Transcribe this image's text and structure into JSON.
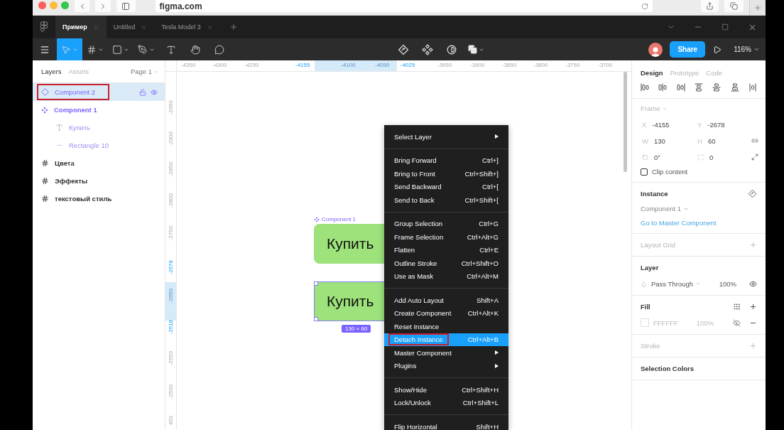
{
  "browser": {
    "url": "figma.com"
  },
  "file_tabs": [
    {
      "label": "Пример",
      "selected": true
    },
    {
      "label": "Untitled",
      "selected": false
    },
    {
      "label": "Tesla Model 3",
      "selected": false
    }
  ],
  "toolbar": {
    "tools": [
      {
        "kind": "move",
        "selected": true
      },
      {
        "kind": "frame",
        "selected": false
      },
      {
        "kind": "shape",
        "selected": false
      },
      {
        "kind": "pen",
        "selected": false
      },
      {
        "kind": "text",
        "selected": false
      },
      {
        "kind": "hand",
        "selected": false
      },
      {
        "kind": "comment",
        "selected": false
      }
    ],
    "share": "Share",
    "zoom": "116%"
  },
  "left_panel": {
    "tabs": [
      {
        "label": "Layers",
        "selected": true
      },
      {
        "label": "Assets",
        "selected": false
      }
    ],
    "page": "Page 1",
    "layers": [
      {
        "kind": "instance",
        "name": "Component 2",
        "selected": true,
        "annotated": true
      },
      {
        "kind": "component",
        "name": "Component 1",
        "selected": false,
        "annotated": false,
        "children": [
          {
            "kind": "text",
            "name": "Купить",
            "selected": false,
            "annotated": false
          },
          {
            "kind": "rectangle",
            "name": "Rectangle 10",
            "selected": false,
            "annotated": false
          }
        ]
      },
      {
        "kind": "frame",
        "name": "Цвета",
        "selected": false,
        "annotated": false
      },
      {
        "kind": "frame",
        "name": "Эффекты",
        "selected": false,
        "annotated": false
      },
      {
        "kind": "frame",
        "name": "текстовый стиль",
        "selected": false,
        "annotated": false
      }
    ]
  },
  "rulers": {
    "top": [
      {
        "label": "-4350",
        "kind": "plain"
      },
      {
        "label": "-4300",
        "kind": "plain"
      },
      {
        "label": "-4250",
        "kind": "plain"
      },
      {
        "label": "-4155",
        "kind": "edge"
      },
      {
        "label": "-4100",
        "kind": "inner"
      },
      {
        "label": "-4050",
        "kind": "inner"
      },
      {
        "label": "-4025",
        "kind": "edge"
      },
      {
        "label": "-3950",
        "kind": "plain"
      },
      {
        "label": "-3900",
        "kind": "plain"
      },
      {
        "label": "-3850",
        "kind": "plain"
      },
      {
        "label": "-3800",
        "kind": "plain"
      },
      {
        "label": "-3750",
        "kind": "plain"
      },
      {
        "label": "-3700",
        "kind": "plain"
      }
    ],
    "left": [
      {
        "label": "-2950",
        "kind": "plain"
      },
      {
        "label": "-2900",
        "kind": "plain"
      },
      {
        "label": "-2850",
        "kind": "plain"
      },
      {
        "label": "-2800",
        "kind": "plain"
      },
      {
        "label": "-2750",
        "kind": "plain"
      },
      {
        "label": "-2678",
        "kind": "edge"
      },
      {
        "label": "-2650",
        "kind": "inner"
      },
      {
        "label": "-2618",
        "kind": "edge"
      },
      {
        "label": "-2550",
        "kind": "plain"
      },
      {
        "label": "-2500",
        "kind": "plain"
      },
      {
        "label": "450",
        "kind": "plain"
      }
    ]
  },
  "canvas": {
    "component_label": "Component 1",
    "buttons": [
      {
        "label": "Купить",
        "selected": false
      },
      {
        "label": "Купить",
        "selected": true
      }
    ],
    "size_badge": "130 × 60"
  },
  "context_menu": {
    "sections": [
      [
        {
          "label": "Select Layer",
          "submenu": true,
          "selected": false,
          "annotated": false
        }
      ],
      [
        {
          "label": "Bring Forward",
          "shortcut": "Ctrl+]",
          "submenu": false,
          "selected": false,
          "annotated": false
        },
        {
          "label": "Bring to Front",
          "shortcut": "Ctrl+Shift+]",
          "submenu": false,
          "selected": false,
          "annotated": false
        },
        {
          "label": "Send Backward",
          "shortcut": "Ctrl+[",
          "submenu": false,
          "selected": false,
          "annotated": false
        },
        {
          "label": "Send to Back",
          "shortcut": "Ctrl+Shift+[",
          "submenu": false,
          "selected": false,
          "annotated": false
        }
      ],
      [
        {
          "label": "Group Selection",
          "shortcut": "Ctrl+G",
          "submenu": false,
          "selected": false,
          "annotated": false
        },
        {
          "label": "Frame Selection",
          "shortcut": "Ctrl+Alt+G",
          "submenu": false,
          "selected": false,
          "annotated": false
        },
        {
          "label": "Flatten",
          "shortcut": "Ctrl+E",
          "submenu": false,
          "selected": false,
          "annotated": false
        },
        {
          "label": "Outline Stroke",
          "shortcut": "Ctrl+Shift+O",
          "submenu": false,
          "selected": false,
          "annotated": false
        },
        {
          "label": "Use as Mask",
          "shortcut": "Ctrl+Alt+M",
          "submenu": false,
          "selected": false,
          "annotated": false
        }
      ],
      [
        {
          "label": "Add Auto Layout",
          "shortcut": "Shift+A",
          "submenu": false,
          "selected": false,
          "annotated": false
        },
        {
          "label": "Create Component",
          "shortcut": "Ctrl+Alt+K",
          "submenu": false,
          "selected": false,
          "annotated": false
        },
        {
          "label": "Reset Instance",
          "submenu": false,
          "selected": false,
          "annotated": false
        },
        {
          "label": "Detach Instance",
          "shortcut": "Ctrl+Alt+B",
          "submenu": false,
          "selected": true,
          "annotated": true
        },
        {
          "label": "Master Component",
          "submenu": true,
          "selected": false,
          "annotated": false
        },
        {
          "label": "Plugins",
          "submenu": true,
          "selected": false,
          "annotated": false
        }
      ],
      [
        {
          "label": "Show/Hide",
          "shortcut": "Ctrl+Shift+H",
          "submenu": false,
          "selected": false,
          "annotated": false
        },
        {
          "label": "Lock/Unlock",
          "shortcut": "Ctrl+Shift+L",
          "submenu": false,
          "selected": false,
          "annotated": false
        }
      ],
      [
        {
          "label": "Flip Horizontal",
          "shortcut": "Shift+H",
          "submenu": false,
          "selected": false,
          "annotated": false
        }
      ]
    ]
  },
  "design_panel": {
    "tabs": [
      {
        "label": "Design",
        "selected": true
      },
      {
        "label": "Prototype",
        "selected": false
      },
      {
        "label": "Code",
        "selected": false
      }
    ],
    "frame": {
      "title": "Frame",
      "fields": [
        {
          "kind": "letter",
          "label": "X",
          "value": "-4155"
        },
        {
          "kind": "letter",
          "label": "Y",
          "value": "-2678"
        },
        {
          "kind": "letter",
          "label": "W",
          "value": "130"
        },
        {
          "kind": "letter",
          "label": "H",
          "value": "60"
        },
        {
          "kind": "rotation",
          "value": "0°"
        },
        {
          "kind": "radius",
          "value": "0"
        }
      ],
      "clip_content": {
        "label": "Clip content",
        "checked": false
      }
    },
    "instance": {
      "title": "Instance",
      "component": "Component 1",
      "link": "Go to Master Component"
    },
    "layout_grid": {
      "title": "Layout Grid"
    },
    "layer": {
      "title": "Layer",
      "blend": "Pass Through",
      "opacity": "100%"
    },
    "fill": {
      "title": "Fill",
      "hex": "FFFFFF",
      "opacity": "100%"
    },
    "stroke": {
      "title": "Stroke"
    },
    "selection_colors": {
      "title": "Selection Colors"
    }
  }
}
